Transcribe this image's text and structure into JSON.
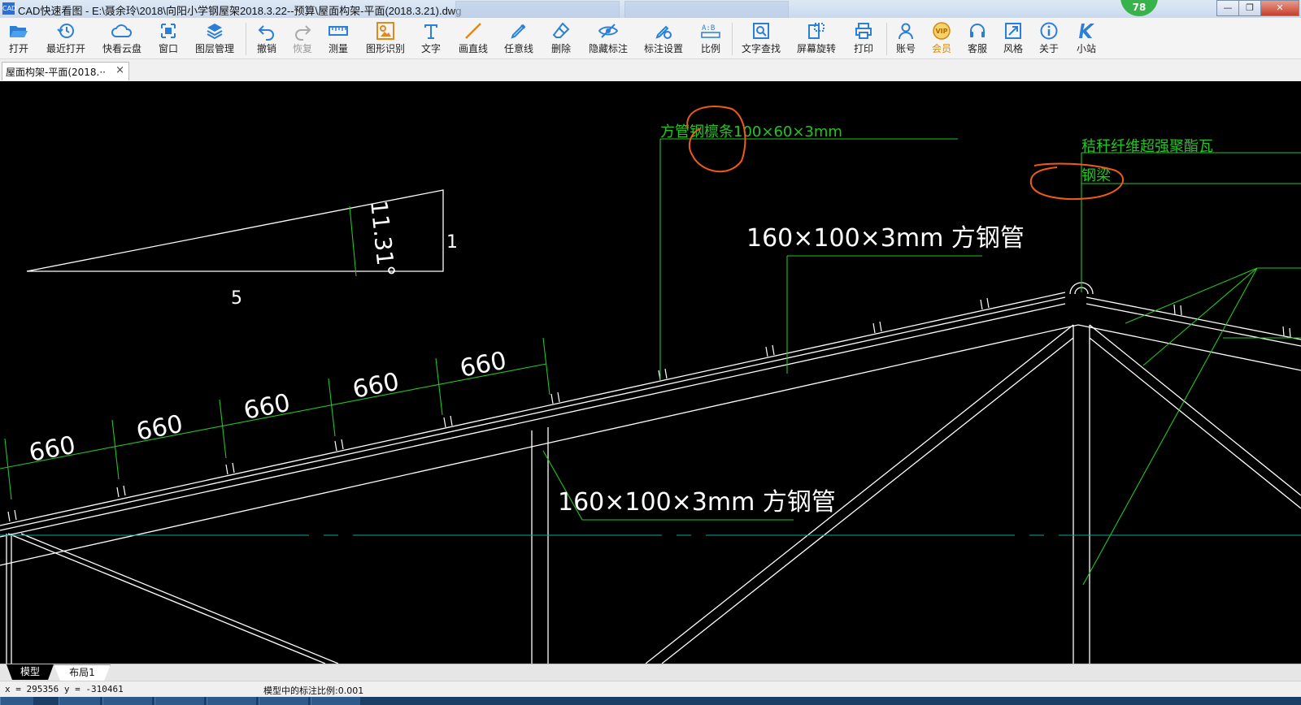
{
  "window": {
    "app_icon_label": "CAD",
    "title": "CAD快速看图 - E:\\聂余玲\\2018\\向阳小学钢屋架2018.3.22--预算\\屋面构架-平面(2018.3.21).dwg",
    "badge_count": "78",
    "minimize_glyph": "—",
    "restore_glyph": "❐",
    "close_glyph": "✕"
  },
  "toolbar": {
    "tools": [
      {
        "label": "打开",
        "icon": "folder-open-icon"
      },
      {
        "label": "最近打开",
        "icon": "recent-icon"
      },
      {
        "label": "快看云盘",
        "icon": "cloud-icon"
      },
      {
        "label": "窗口",
        "icon": "window-icon"
      },
      {
        "label": "图层管理",
        "icon": "layers-icon"
      },
      {
        "label": "撤销",
        "icon": "undo-icon"
      },
      {
        "label": "恢复",
        "icon": "redo-icon"
      },
      {
        "label": "测量",
        "icon": "ruler-icon"
      },
      {
        "label": "图形识别",
        "icon": "shape-recognize-icon"
      },
      {
        "label": "文字",
        "icon": "text-icon"
      },
      {
        "label": "画直线",
        "icon": "line-icon"
      },
      {
        "label": "任意线",
        "icon": "freehand-icon"
      },
      {
        "label": "删除",
        "icon": "eraser-icon"
      },
      {
        "label": "隐藏标注",
        "icon": "eye-hide-icon"
      },
      {
        "label": "标注设置",
        "icon": "annotation-settings-icon"
      },
      {
        "label": "比例",
        "icon": "scale-icon"
      },
      {
        "label": "文字查找",
        "icon": "text-search-icon"
      },
      {
        "label": "屏幕旋转",
        "icon": "rotate-screen-icon"
      },
      {
        "label": "打印",
        "icon": "printer-icon"
      },
      {
        "label": "账号",
        "icon": "account-icon"
      },
      {
        "label": "会员",
        "icon": "vip-icon"
      },
      {
        "label": "客服",
        "icon": "headset-icon"
      },
      {
        "label": "风格",
        "icon": "style-icon"
      },
      {
        "label": "关于",
        "icon": "info-icon"
      },
      {
        "label": "小站",
        "icon": "station-icon"
      }
    ]
  },
  "doc_tab": {
    "label": "屋面构架-平面(2018.··",
    "close_glyph": "×"
  },
  "drawing": {
    "slope_rise": "1",
    "slope_run": "5",
    "slope_angle": "11.31°",
    "dim_values": [
      "660",
      "660",
      "660",
      "660",
      "660"
    ],
    "purlin_note": "方管钢檩条100×60×3mm",
    "pipe_note_top": "160×100×3mm 方钢管",
    "pipe_note_bottom": "160×100×3mm 方钢管",
    "roof_note": "秸秆纤维超强聚酯瓦",
    "steel_frame_note": "钢梁"
  },
  "layout_tabs": {
    "model": "模型",
    "layout1": "布局1"
  },
  "status": {
    "coordinates": "x = 295356 y = -310461",
    "scale_text": "模型中的标注比例:0.001"
  },
  "colors": {
    "canvas_bg": "#000000",
    "cad_line": "#ffffff",
    "cad_green": "#22c622",
    "markup_orange": "#f05a1a",
    "vip_gold": "#d08a12"
  }
}
